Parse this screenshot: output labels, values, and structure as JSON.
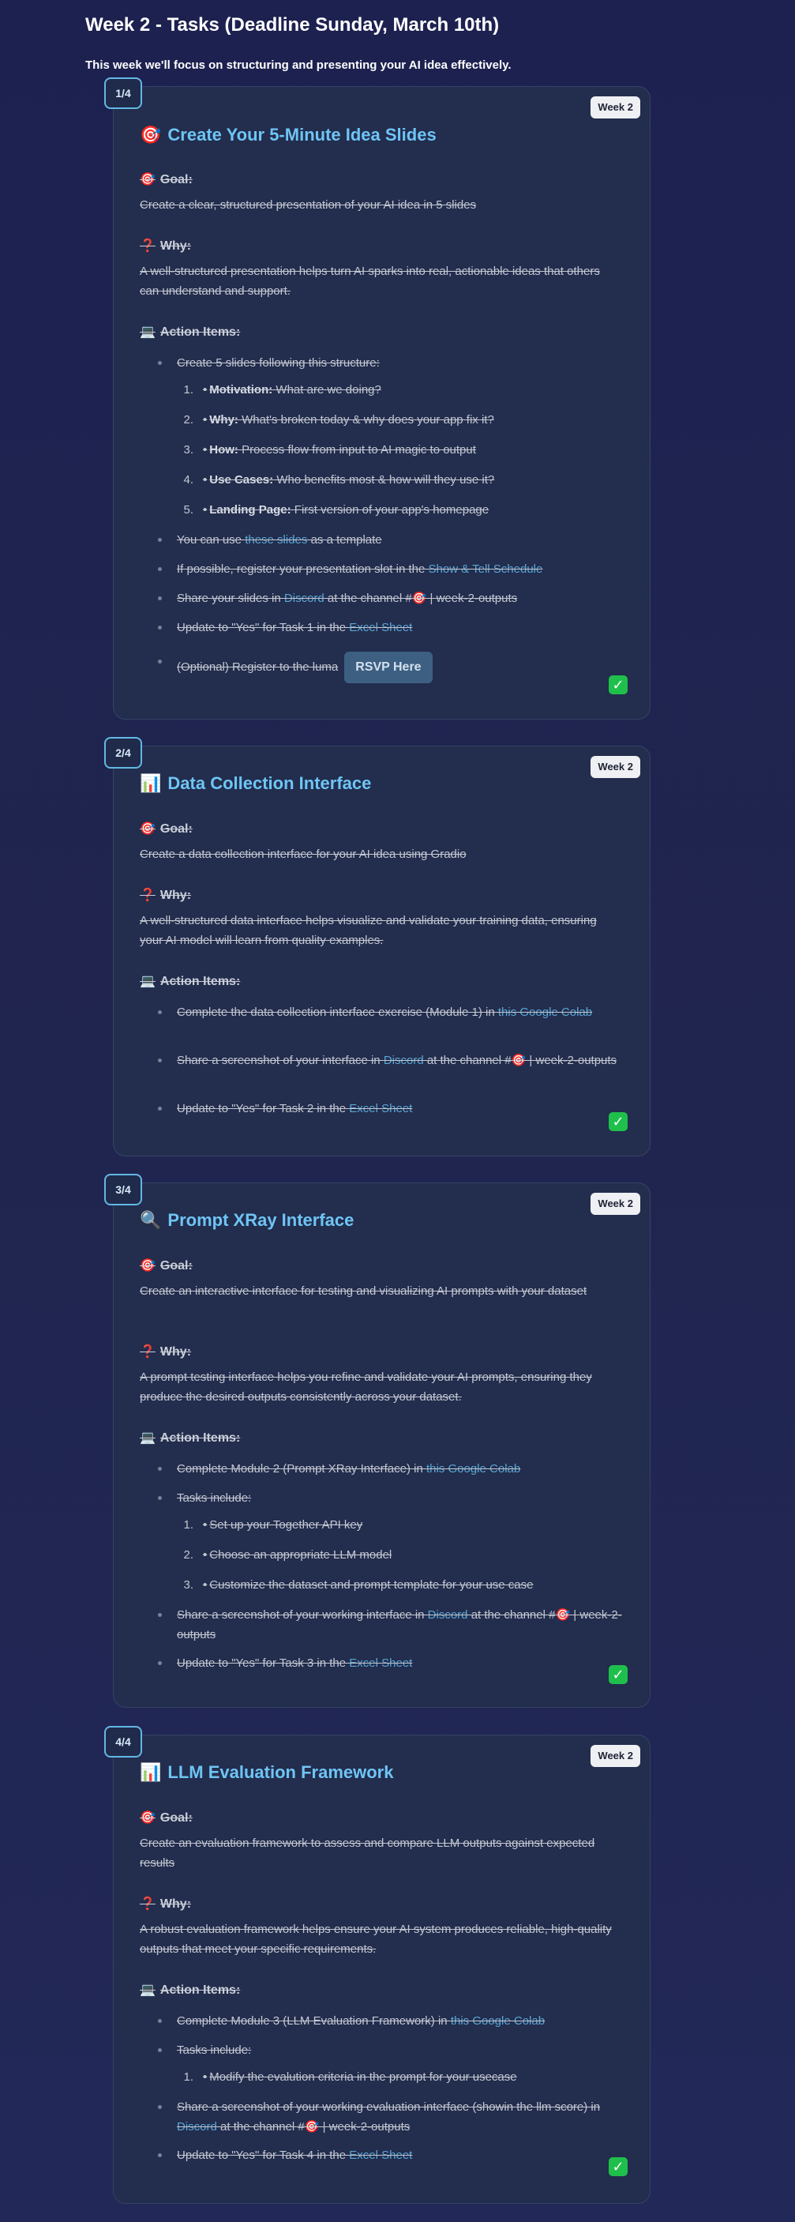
{
  "header": {
    "title": "Week 2 - Tasks (Deadline Sunday, March 10th)",
    "subtitle": "This week we'll focus on structuring and presenting your AI idea effectively."
  },
  "labels": {
    "goal": "Goal:",
    "why": "Why:",
    "action_items": "Action Items:",
    "week_badge": "Week 2"
  },
  "icons": {
    "goal": "dart-icon",
    "why": "question-icon",
    "action": "laptop-icon",
    "done": "checkmark-icon"
  },
  "colors": {
    "accent": "#6ec5f5",
    "link": "#5aa7d6",
    "done": "#1fbf4c",
    "badge_bg": "#eef0f4"
  },
  "tasks": [
    {
      "step": "1/4",
      "title_emoji": "🎯",
      "title": "Create Your 5-Minute Idea Slides",
      "goal": "Create a clear, structured presentation of your AI idea in 5 slides",
      "why": "A well-structured presentation helps turn AI sparks into real, actionable ideas that others can understand and support.",
      "items": {
        "i0": "Create 5 slides following this structure:",
        "sub": [
          {
            "n": "1.",
            "label": "Motivation:",
            "text": " What are we doing?"
          },
          {
            "n": "2.",
            "label": "Why:",
            "text": " What's broken today & why does your app fix it?"
          },
          {
            "n": "3.",
            "label": "How:",
            "text": " Process flow from input to AI magic to output"
          },
          {
            "n": "4.",
            "label": "Use Cases:",
            "text": " Who benefits most & how will they use it?"
          },
          {
            "n": "5.",
            "label": "Landing Page:",
            "text": " First version of your app's homepage"
          }
        ],
        "i1a": "You can use ",
        "i1link": "these slides",
        "i1b": " as a template",
        "i2a": "If possible, register your presentation slot in the ",
        "i2link": "Show & Tell Schedule",
        "i3a": "Share your slides in ",
        "i3link": "Discord",
        "i3b": " at the channel #🎯 | week-2-outputs",
        "i4a": "Update to \"Yes\" for Task 1 in the ",
        "i4link": "Excel Sheet",
        "i5a": "(Optional) Register to the luma",
        "rsvp": "RSVP Here"
      }
    },
    {
      "step": "2/4",
      "title_emoji": "📊",
      "title": "Data Collection Interface",
      "goal": "Create a data collection interface for your AI idea using Gradio",
      "why": "A well-structured data interface helps visualize and validate your training data, ensuring your AI model will learn from quality examples.",
      "items": {
        "i0a": "Complete the data collection interface exercise (Module 1) in ",
        "i0link": "this Google Colab",
        "i1a": "Share a screenshot of your interface in ",
        "i1link": "Discord",
        "i1b": " at the channel #🎯 | week-2-outputs",
        "i2a": "Update to \"Yes\" for Task 2 in the ",
        "i2link": "Excel Sheet"
      }
    },
    {
      "step": "3/4",
      "title_emoji": "🔍",
      "title": "Prompt XRay Interface",
      "goal": "Create an interactive interface for testing and visualizing AI prompts with your dataset",
      "why": "A prompt testing interface helps you refine and validate your AI prompts, ensuring they produce the desired outputs consistently across your dataset.",
      "items": {
        "i0a": "Complete Module 2 (Prompt XRay Interface) in ",
        "i0link": "this Google Colab",
        "i1": "Tasks include:",
        "sub": [
          {
            "n": "1.",
            "text": "Set up your Together API key"
          },
          {
            "n": "2.",
            "text": "Choose an appropriate LLM model"
          },
          {
            "n": "3.",
            "text": "Customize the dataset and prompt template for your use case"
          }
        ],
        "i2a": "Share a screenshot of your working interface in ",
        "i2link": "Discord",
        "i2b": " at the channel #🎯 | week-2-outputs",
        "i3a": "Update to \"Yes\" for Task 3 in the ",
        "i3link": "Excel Sheet"
      }
    },
    {
      "step": "4/4",
      "title_emoji": "📊",
      "title": "LLM Evaluation Framework",
      "goal": "Create an evaluation framework to assess and compare LLM outputs against expected results",
      "why": "A robust evaluation framework helps ensure your AI system produces reliable, high-quality outputs that meet your specific requirements.",
      "items": {
        "i0a": "Complete Module 3 (LLM Evaluation Framework) in ",
        "i0link": "this Google Colab",
        "i1": "Tasks include:",
        "sub": [
          {
            "n": "1.",
            "text": "Modify the evalution criteria in the prompt for your usecase"
          }
        ],
        "i2a": "Share a screenshot of your working evaluation interface (showin the llm score) in ",
        "i2link": "Discord",
        "i2b": " at the channel #🎯 | week-2-outputs",
        "i3a": "Update to \"Yes\" for Task 4 in the ",
        "i3link": "Excel Sheet"
      }
    }
  ]
}
